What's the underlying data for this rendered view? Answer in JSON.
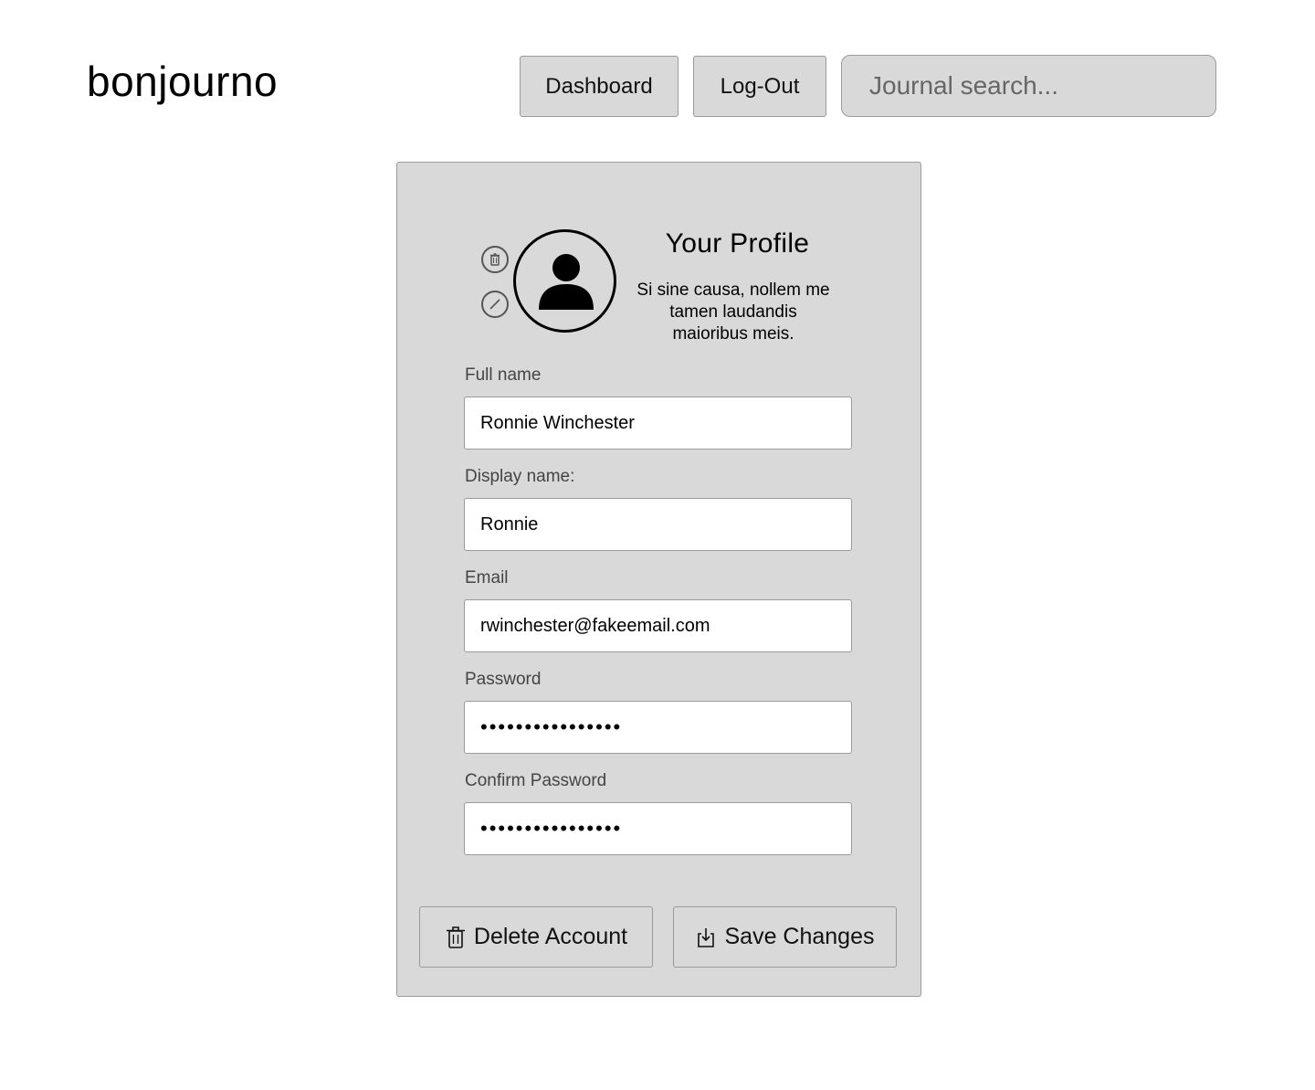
{
  "header": {
    "logo": "bonjourno",
    "nav": {
      "dashboard_label": "Dashboard",
      "logout_label": "Log-Out"
    },
    "search": {
      "placeholder": "Journal search...",
      "value": ""
    }
  },
  "profile": {
    "title": "Your Profile",
    "description": "Si sine causa, nollem me tamen laudandis maioribus meis.",
    "avatar_icon": "user-silhouette-icon",
    "side_icons": [
      "trash-icon",
      "edit-icon"
    ]
  },
  "form": {
    "full_name": {
      "label": "Full name",
      "value": "Ronnie Winchester"
    },
    "display_name": {
      "label": "Display name:",
      "value": "Ronnie"
    },
    "email": {
      "label": "Email",
      "value": "rwinchester@fakeemail.com"
    },
    "password": {
      "label": "Password",
      "value": "••••••••••••••••"
    },
    "confirm_password": {
      "label": "Confirm Password",
      "value": "••••••••••••••••"
    }
  },
  "actions": {
    "delete_label": "Delete Account",
    "save_label": "Save Changes"
  }
}
